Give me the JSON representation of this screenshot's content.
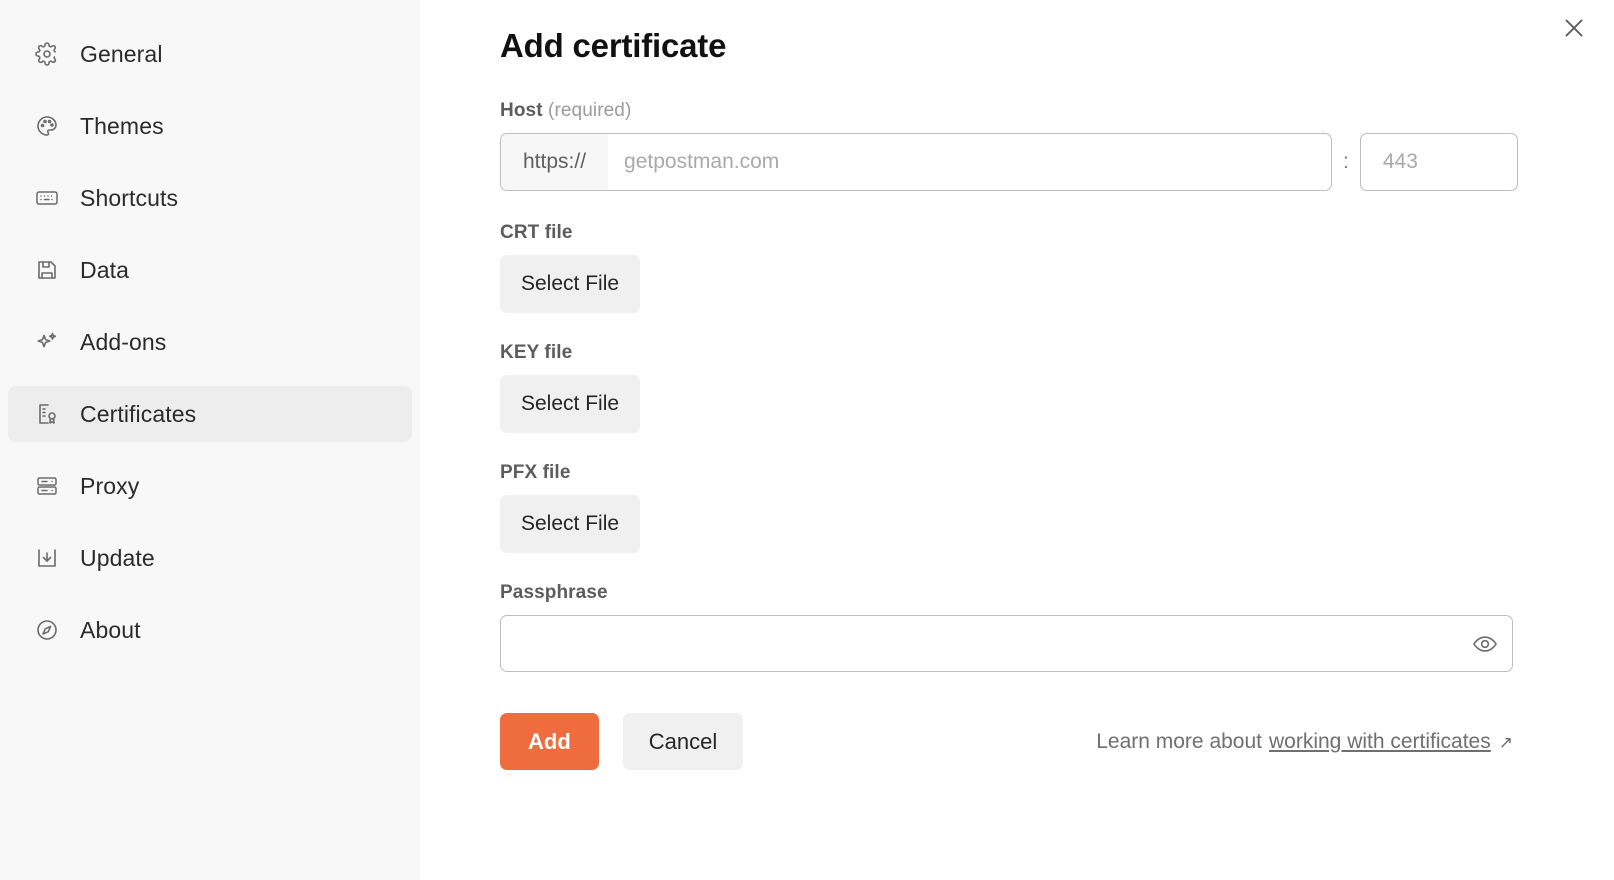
{
  "sidebar": {
    "items": [
      {
        "label": "General",
        "icon": "gear-icon",
        "active": false
      },
      {
        "label": "Themes",
        "icon": "palette-icon",
        "active": false
      },
      {
        "label": "Shortcuts",
        "icon": "keyboard-icon",
        "active": false
      },
      {
        "label": "Data",
        "icon": "floppy-disk-icon",
        "active": false
      },
      {
        "label": "Add-ons",
        "icon": "sparkles-icon",
        "active": false
      },
      {
        "label": "Certificates",
        "icon": "certificate-icon",
        "active": true
      },
      {
        "label": "Proxy",
        "icon": "server-icon",
        "active": false
      },
      {
        "label": "Update",
        "icon": "download-box-icon",
        "active": false
      },
      {
        "label": "About",
        "icon": "info-circle-icon",
        "active": false
      }
    ]
  },
  "main": {
    "title": "Add certificate",
    "close_icon": "close-icon",
    "host": {
      "label": "Host",
      "required_note": "(required)",
      "protocol_prefix": "https://",
      "value": "",
      "placeholder": "getpostman.com",
      "separator": ":",
      "port_value": "",
      "port_placeholder": "443"
    },
    "crt": {
      "label": "CRT file",
      "button_label": "Select File"
    },
    "key": {
      "label": "KEY file",
      "button_label": "Select File"
    },
    "pfx": {
      "label": "PFX file",
      "button_label": "Select File"
    },
    "passphrase": {
      "label": "Passphrase",
      "value": "",
      "placeholder": "",
      "reveal_icon": "eye-icon"
    },
    "actions": {
      "add_label": "Add",
      "cancel_label": "Cancel"
    },
    "learn_more": {
      "prefix": "Learn more about",
      "link_text": "working with certificates",
      "external_arrow": "↗"
    }
  },
  "colors": {
    "accent": "#ef6c3e",
    "sidebar_bg": "#f8f8f8",
    "active_item_bg": "#ededed",
    "button_bg": "#f0f0f0",
    "border": "#bdbdbd",
    "text": "#1f1f1f",
    "muted_text": "#6f6f6f"
  }
}
